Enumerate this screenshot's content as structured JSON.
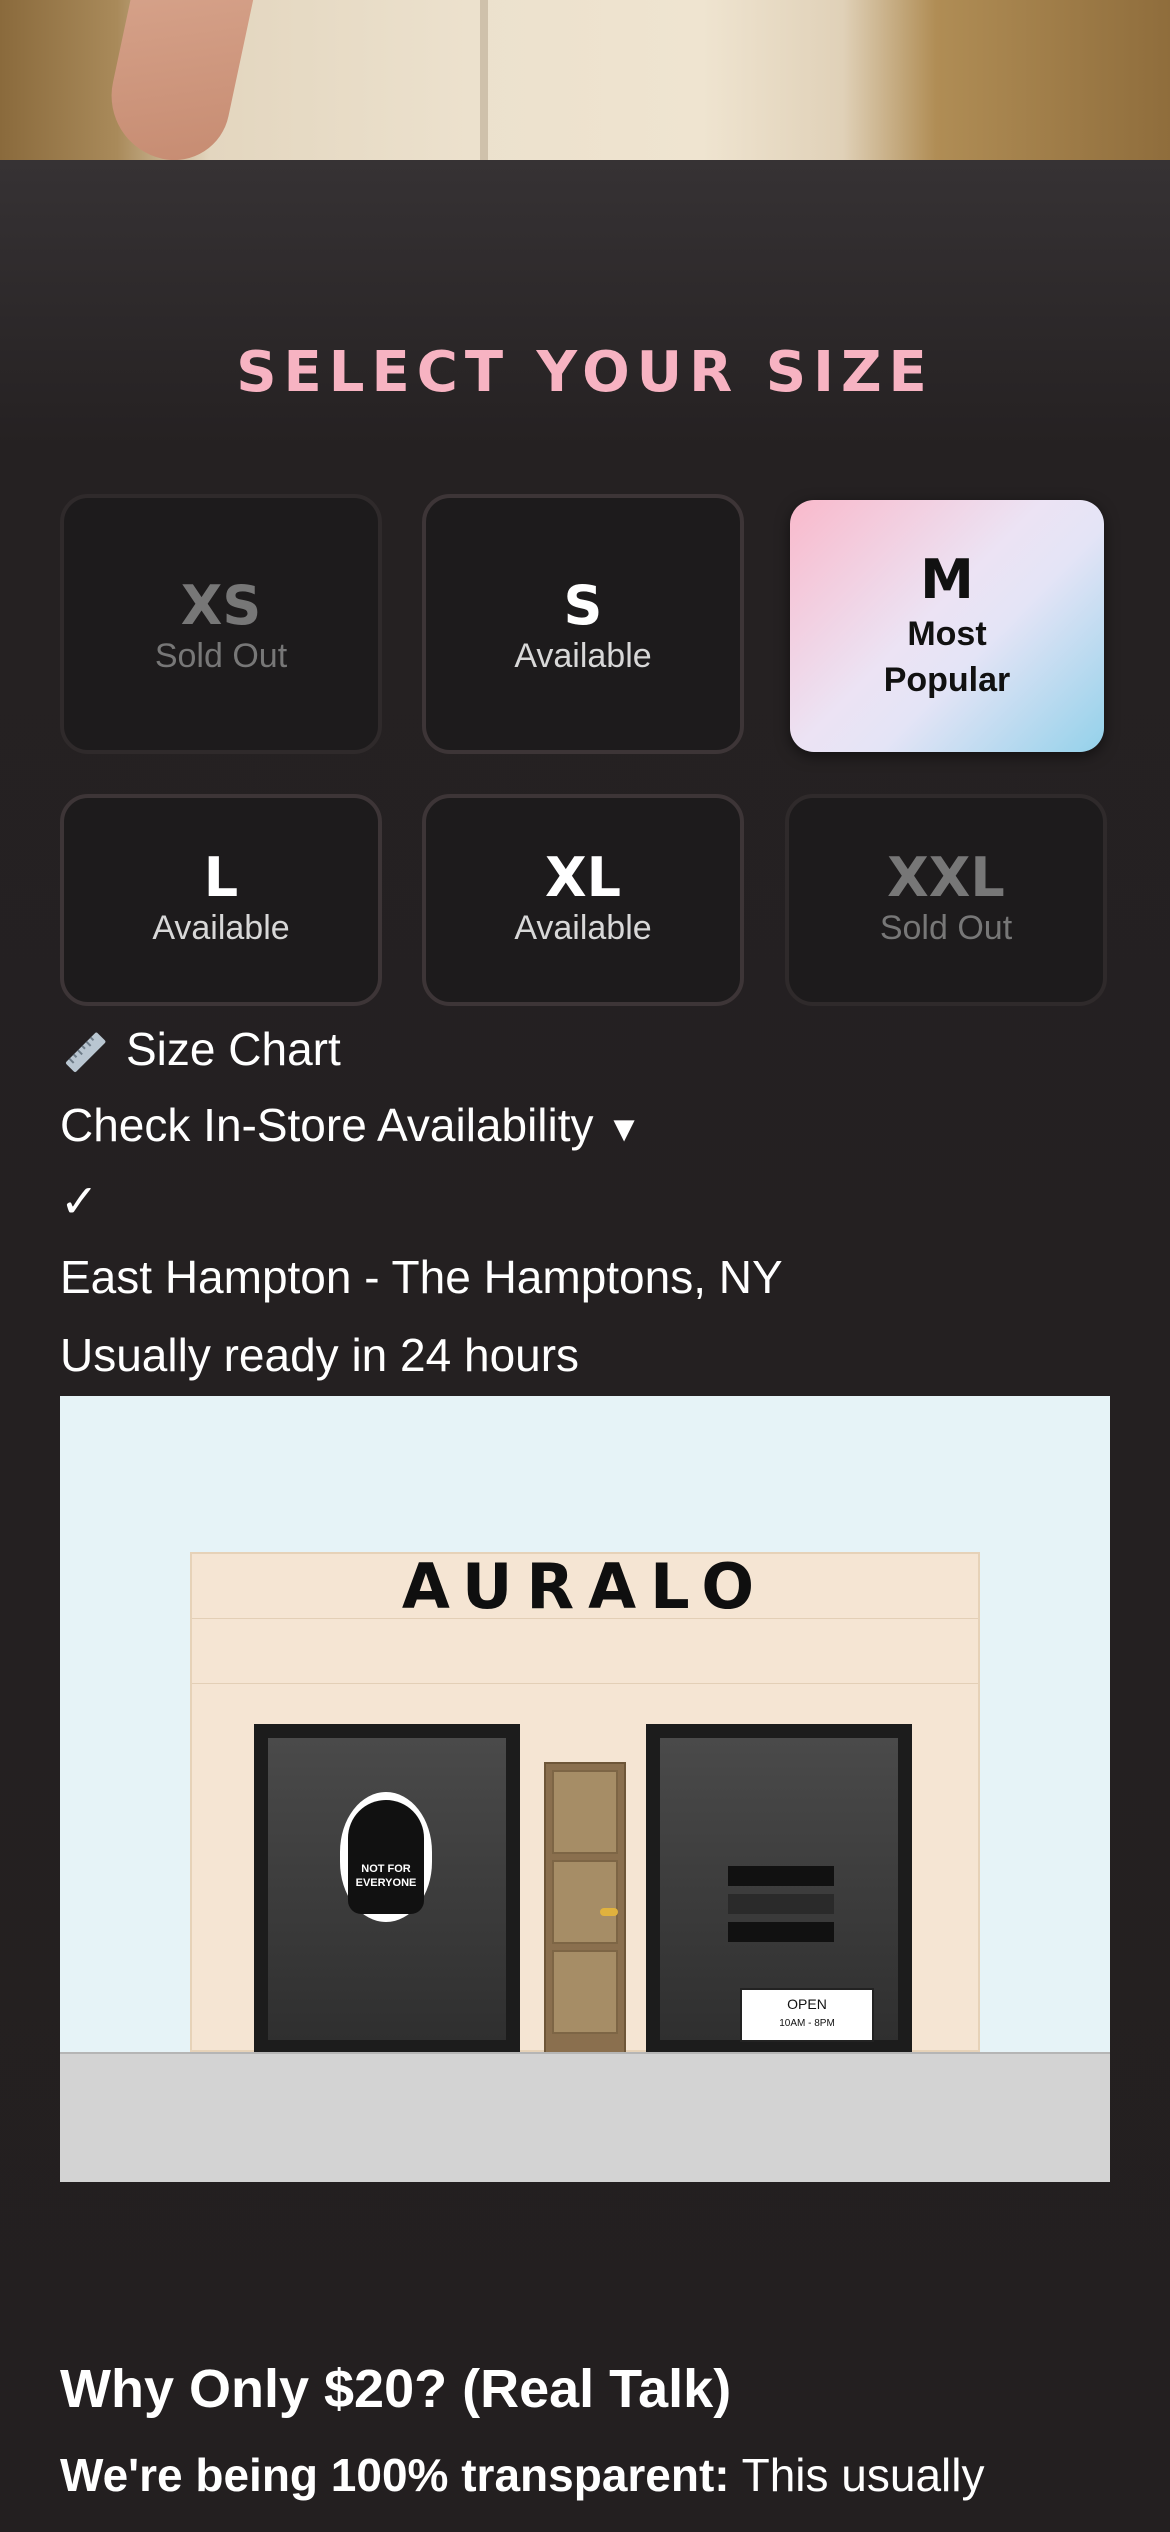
{
  "sizes": {
    "title": "SELECT YOUR SIZE",
    "options": [
      {
        "code": "XS",
        "status": "Sold Out",
        "state": "sold-out"
      },
      {
        "code": "S",
        "status": "Available",
        "state": "available"
      },
      {
        "code": "M",
        "status": "Most Popular",
        "state": "selected"
      },
      {
        "code": "L",
        "status": "Available",
        "state": "available"
      },
      {
        "code": "XL",
        "status": "Available",
        "state": "available"
      },
      {
        "code": "XXL",
        "status": "Sold Out",
        "state": "sold-out"
      }
    ]
  },
  "links": {
    "size_chart": "Size Chart",
    "size_chart_icon": "ruler-icon",
    "check_store": "Check In-Store Availability",
    "check_store_arrow": "▼",
    "checkmark": "✓"
  },
  "store": {
    "location": "East Hampton - The Hamptons, NY",
    "ready": "Usually ready in 24 hours",
    "sign": "AURALO",
    "poster_text_1": "NOT FOR",
    "poster_text_2": "EVERYONE",
    "open_label": "OPEN",
    "hours": "10AM - 8PM"
  },
  "why": {
    "heading": "Why Only $20? (Real Talk)",
    "lead_bold": "We're being 100% transparent:",
    "lead_rest": " This usually"
  },
  "colors": {
    "accent": "#f7b3c2",
    "background": "#231f20"
  }
}
